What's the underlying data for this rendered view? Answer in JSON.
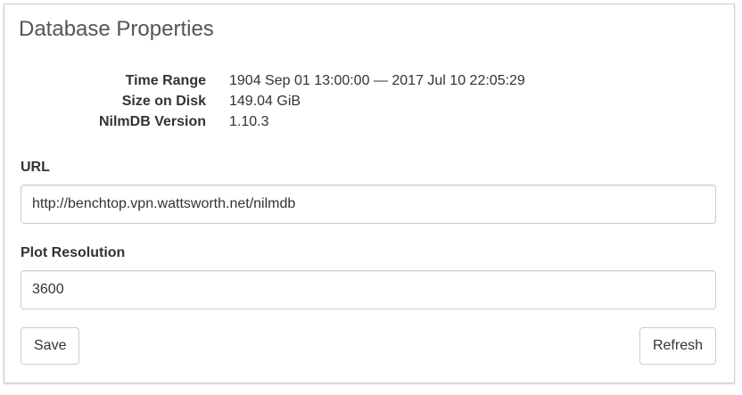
{
  "panel": {
    "title": "Database Properties"
  },
  "properties": [
    {
      "key": "Time Range",
      "value": "1904 Sep 01 13:00:00 — 2017 Jul 10 22:05:29"
    },
    {
      "key": "Size on Disk",
      "value": "149.04 GiB"
    },
    {
      "key": "NilmDB Version",
      "value": "1.10.3"
    }
  ],
  "url_field": {
    "label": "URL",
    "value": "http://benchtop.vpn.wattsworth.net/nilmdb"
  },
  "resolution_field": {
    "label": "Plot Resolution",
    "value": "3600"
  },
  "buttons": {
    "save_label": "Save",
    "refresh_label": "Refresh"
  }
}
